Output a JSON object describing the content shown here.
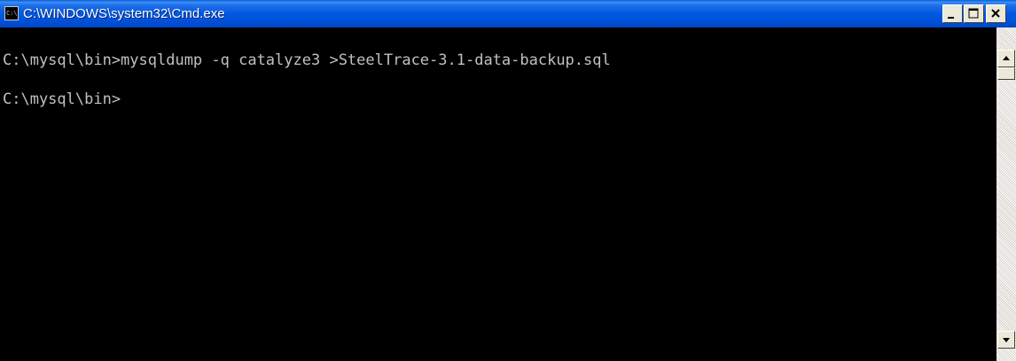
{
  "window": {
    "title": "C:\\WINDOWS\\system32\\Cmd.exe",
    "icon": "cmd-console-icon",
    "icon_text": "C:\\",
    "controls": {
      "minimize": "minimize-icon",
      "maximize": "maximize-icon",
      "close": "close-icon"
    }
  },
  "console": {
    "lines": [
      "C:\\mysql\\bin>mysqldump -q catalyze3 >SteelTrace-3.1-data-backup.sql",
      "C:\\mysql\\bin>"
    ],
    "text_color": "#c0c0c0",
    "background_color": "#000000"
  },
  "colors": {
    "titlebar": "#0058e2",
    "title_text": "#ffffff",
    "button_face": "#ece9d8"
  }
}
